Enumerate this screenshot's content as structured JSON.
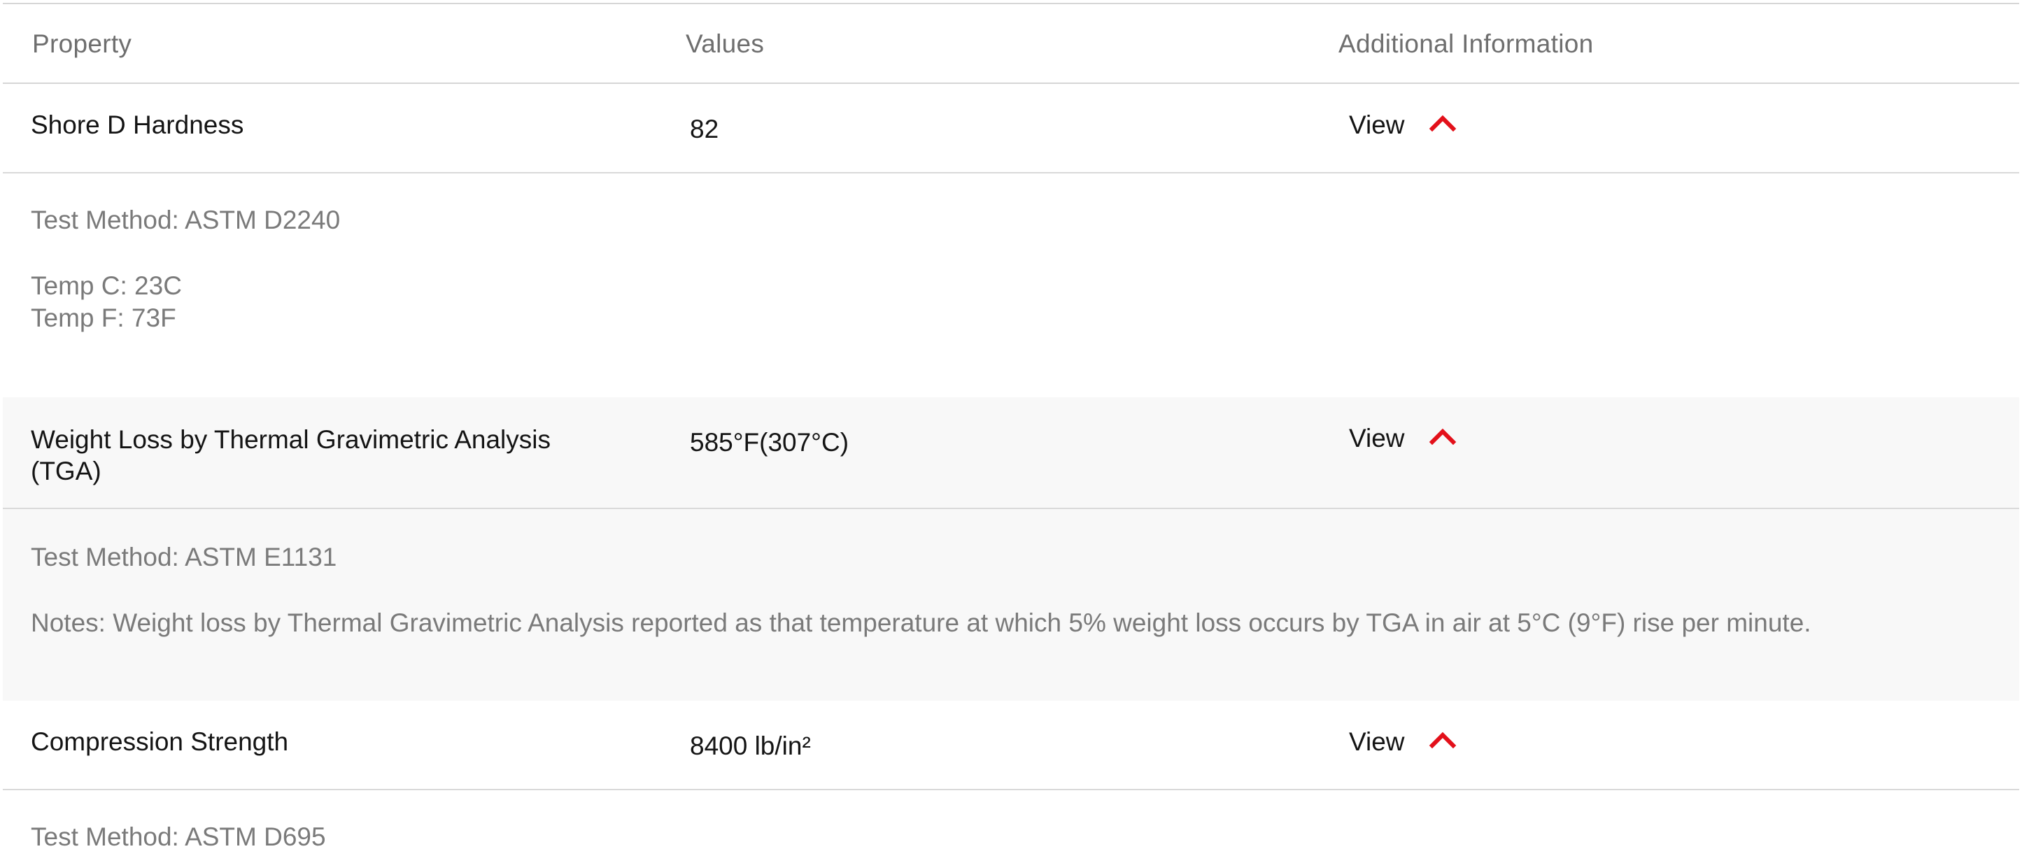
{
  "header": {
    "property": "Property",
    "values": "Values",
    "additional": "Additional Information"
  },
  "rows": [
    {
      "property": "Shore D Hardness",
      "value": "82",
      "view_label": "View",
      "details": {
        "test_method": "Test Method: ASTM D2240",
        "temp_c": "Temp C: 23C",
        "temp_f": "Temp F: 73F"
      }
    },
    {
      "property": "Weight Loss by Thermal Gravimetric Analysis (TGA)",
      "value": "585°F(307°C)",
      "view_label": "View",
      "details": {
        "test_method": "Test Method: ASTM E1131",
        "notes": "Notes: Weight loss by Thermal Gravimetric Analysis reported as that temperature at which 5% weight loss occurs by TGA in air at 5°C (9°F) rise per minute."
      }
    },
    {
      "property": "Compression Strength",
      "value": "8400 lb/in²",
      "view_label": "View",
      "details": {
        "test_method": "Test Method: ASTM D695"
      }
    }
  ],
  "icons": {
    "expand_toggle": "chevron-up-icon"
  },
  "colors": {
    "accent": "#e3101a",
    "row_shade": "#f8f8f8",
    "muted_text": "#7a7a7a",
    "rule": "#d6d6d6"
  }
}
